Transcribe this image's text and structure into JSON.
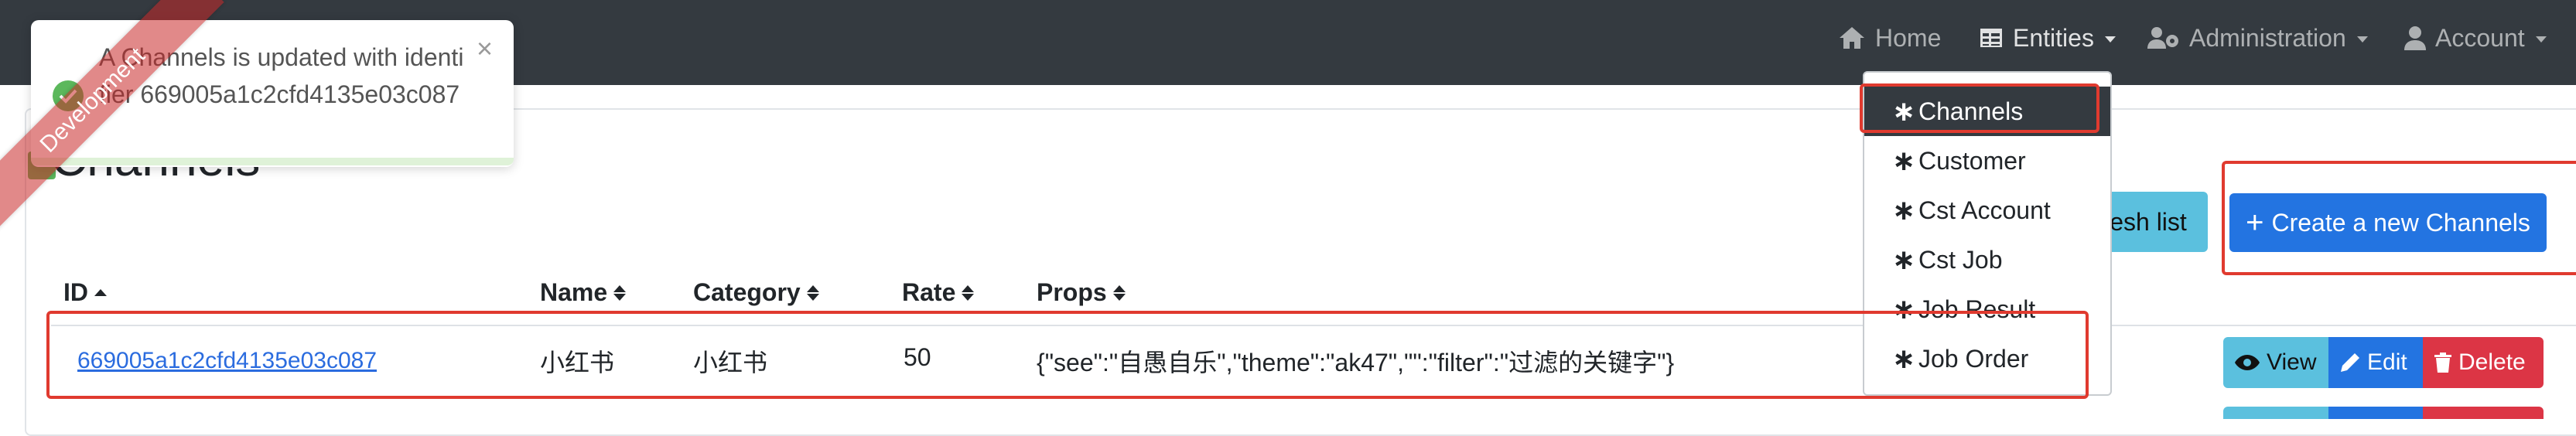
{
  "navbar": {
    "home": "Home",
    "entities": "Entities",
    "administration": "Administration",
    "account": "Account"
  },
  "ribbon": {
    "label": "Development"
  },
  "toast": {
    "message": "A Channels is updated with identifier 669005a1c2cfd4135e03c087",
    "close": "×"
  },
  "page": {
    "title": "Channels",
    "refresh_label": "esh list",
    "create_label": "Create a new Channels"
  },
  "table": {
    "headers": [
      "ID",
      "Name",
      "Category",
      "Rate",
      "Props"
    ],
    "row": {
      "id": "669005a1c2cfd4135e03c087",
      "name": "小红书",
      "category": "小红书",
      "rate": "50",
      "props": "{\"see\":\"自愚自乐\",\"theme\":\"ak47\",\"\":\"filter\":\"过滤的关键字\"}"
    },
    "actions": {
      "view": "View",
      "edit": "Edit",
      "delete": "Delete"
    }
  },
  "dropdown": {
    "items": [
      "Channels",
      "Customer",
      "Cst Account",
      "Cst Job",
      "Job Result",
      "Job Order"
    ],
    "active": "Channels"
  },
  "colors": {
    "navbar": "#343a40",
    "primary": "#2374e1",
    "info": "#5bc0de",
    "danger": "#dc3545",
    "annotation": "#e03a2f"
  }
}
